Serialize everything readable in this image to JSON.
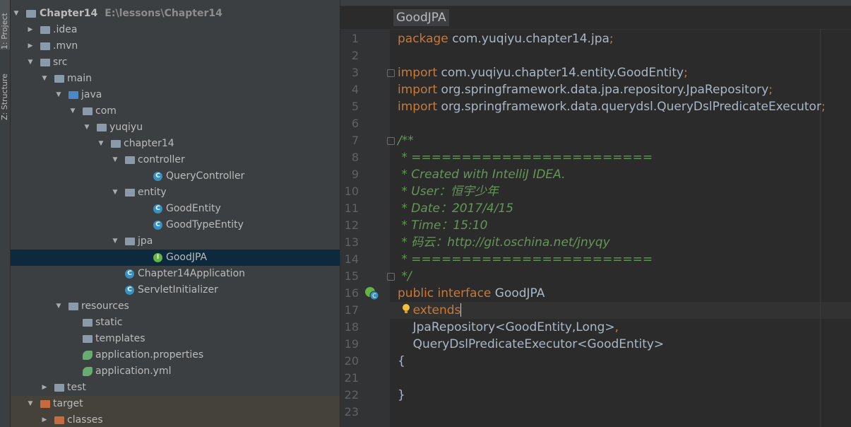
{
  "side_tabs": [
    {
      "label": "1: Project"
    },
    {
      "label": "Z: Structure"
    }
  ],
  "project_root": {
    "name": "Chapter14",
    "path": "E:\\lessons\\Chapter14"
  },
  "tree": [
    {
      "label": ".idea"
    },
    {
      "label": ".mvn"
    },
    {
      "label": "src"
    },
    {
      "label": "main"
    },
    {
      "label": "java"
    },
    {
      "label": "com"
    },
    {
      "label": "yuqiyu"
    },
    {
      "label": "chapter14"
    },
    {
      "label": "controller"
    },
    {
      "label": "QueryController"
    },
    {
      "label": "entity"
    },
    {
      "label": "GoodEntity"
    },
    {
      "label": "GoodTypeEntity"
    },
    {
      "label": "jpa"
    },
    {
      "label": "GoodJPA"
    },
    {
      "label": "Chapter14Application"
    },
    {
      "label": "ServletInitializer"
    },
    {
      "label": "resources"
    },
    {
      "label": "static"
    },
    {
      "label": "templates"
    },
    {
      "label": "application.properties"
    },
    {
      "label": "application.yml"
    },
    {
      "label": "test"
    },
    {
      "label": "target"
    },
    {
      "label": "classes"
    }
  ],
  "editor": {
    "breadcrumb": "GoodJPA",
    "line_numbers": [
      "1",
      "2",
      "3",
      "4",
      "5",
      "6",
      "7",
      "8",
      "9",
      "10",
      "11",
      "12",
      "13",
      "14",
      "15",
      "16",
      "17",
      "18",
      "19",
      "20",
      "21",
      "22",
      "23"
    ],
    "lines": [
      {
        "n": 1,
        "parts": [
          {
            "t": "package ",
            "c": "kw"
          },
          {
            "t": "com.yuqiyu.chapter14.jpa"
          },
          {
            "t": ";",
            "c": "kw"
          }
        ]
      },
      {
        "n": 3,
        "parts": [
          {
            "t": "import ",
            "c": "kw"
          },
          {
            "t": "com.yuqiyu.chapter14.entity.GoodEntity"
          },
          {
            "t": ";",
            "c": "kw"
          }
        ]
      },
      {
        "n": 4,
        "parts": [
          {
            "t": "import ",
            "c": "kw"
          },
          {
            "t": "org.springframework.data.jpa.repository.JpaRepository"
          },
          {
            "t": ";",
            "c": "kw"
          }
        ]
      },
      {
        "n": 5,
        "parts": [
          {
            "t": "import ",
            "c": "kw"
          },
          {
            "t": "org.springframework.data.querydsl.QueryDslPredicateExecutor"
          },
          {
            "t": ";",
            "c": "kw"
          }
        ]
      },
      {
        "n": 7,
        "parts": [
          {
            "t": "/**",
            "c": "cm"
          }
        ]
      },
      {
        "n": 8,
        "parts": [
          {
            "t": " * ========================",
            "c": "cm"
          }
        ]
      },
      {
        "n": 9,
        "parts": [
          {
            "t": " * Created with IntelliJ IDEA.",
            "c": "cm"
          }
        ]
      },
      {
        "n": 10,
        "parts": [
          {
            "t": " * User：恒宇少年",
            "c": "cm"
          }
        ]
      },
      {
        "n": 11,
        "parts": [
          {
            "t": " * Date：2017/4/15",
            "c": "cm"
          }
        ]
      },
      {
        "n": 12,
        "parts": [
          {
            "t": " * Time：15:10",
            "c": "cm"
          }
        ]
      },
      {
        "n": 13,
        "parts": [
          {
            "t": " * 码云：http://git.oschina.net/jnyqy",
            "c": "cm"
          }
        ]
      },
      {
        "n": 14,
        "parts": [
          {
            "t": " * ========================",
            "c": "cm"
          }
        ]
      },
      {
        "n": 15,
        "parts": [
          {
            "t": " */",
            "c": "cm"
          }
        ]
      },
      {
        "n": 16,
        "parts": [
          {
            "t": "public interface ",
            "c": "kw"
          },
          {
            "t": "GoodJPA"
          }
        ]
      },
      {
        "n": 17,
        "parts": [
          {
            "t": "    extends",
            "c": "kw"
          }
        ]
      },
      {
        "n": 18,
        "parts": [
          {
            "t": "    JpaRepository<GoodEntity,Long>"
          },
          {
            "t": ",",
            "c": "kw"
          }
        ]
      },
      {
        "n": 19,
        "parts": [
          {
            "t": "    QueryDslPredicateExecutor<GoodEntity>"
          }
        ]
      },
      {
        "n": 20,
        "parts": [
          {
            "t": "{"
          }
        ]
      },
      {
        "n": 22,
        "parts": [
          {
            "t": "}"
          }
        ]
      }
    ],
    "current_line": 17,
    "colors": {
      "keyword": "#cc7832",
      "comment": "#629755",
      "text": "#a9b7c6"
    }
  }
}
